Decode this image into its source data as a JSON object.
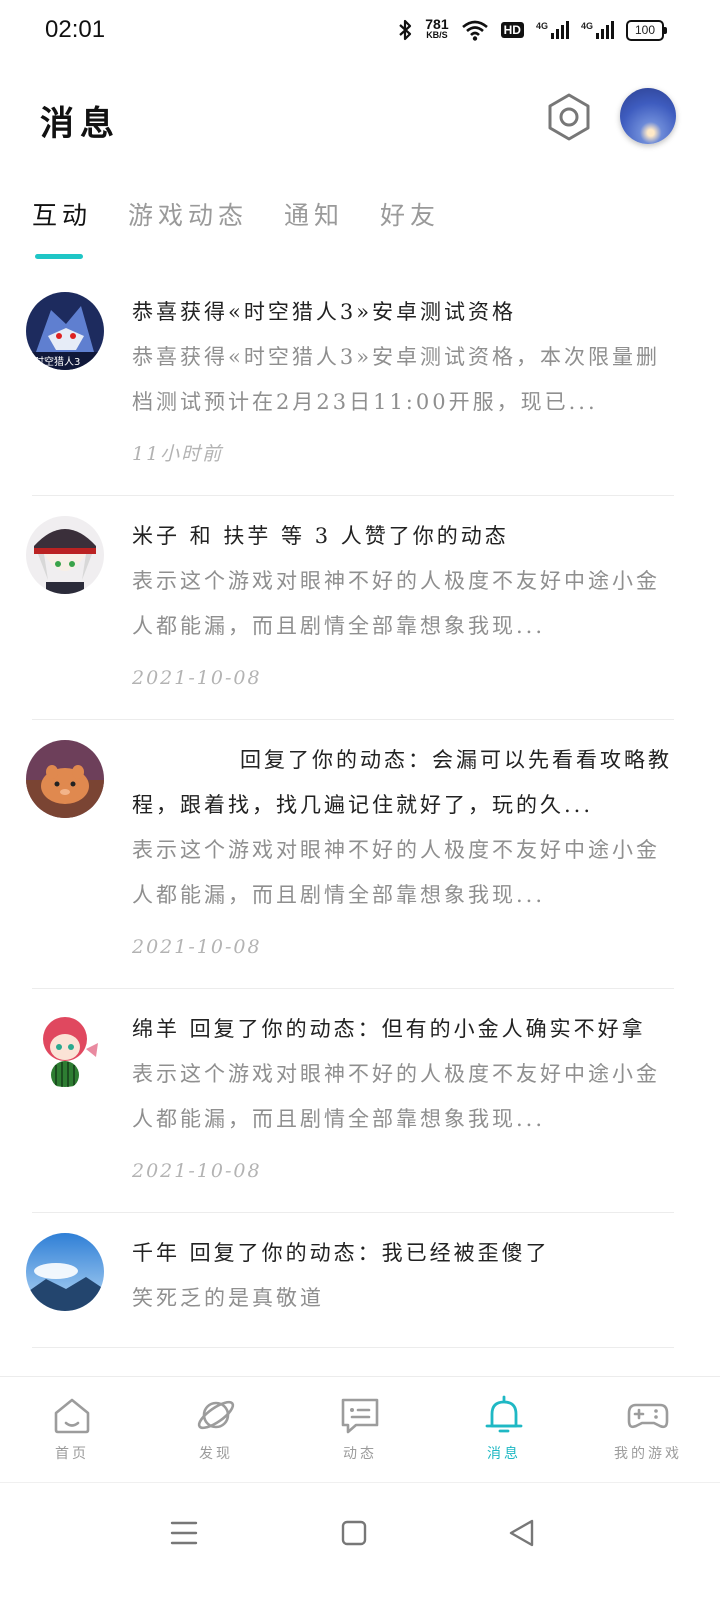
{
  "status_bar": {
    "time": "02:01",
    "net_speed_value": "781",
    "net_speed_unit": "KB/S",
    "hd_label": "HD",
    "signal_1_label": "4G",
    "signal_2_label": "4G",
    "battery_level": "100",
    "icons": [
      "bluetooth-icon",
      "wifi-icon",
      "hd-icon",
      "signal-icon",
      "battery-icon"
    ]
  },
  "header": {
    "title": "消息",
    "settings_icon": "hexagon-settings-icon"
  },
  "tabs": [
    {
      "label": "互动",
      "active": true
    },
    {
      "label": "游戏动态",
      "active": false
    },
    {
      "label": "通知",
      "active": false
    },
    {
      "label": "好友",
      "active": false
    }
  ],
  "accent_color": "#1fc6c6",
  "messages": [
    {
      "title": "恭喜获得«时空猎人3»安卓测试资格",
      "body": "恭喜获得«时空猎人3»安卓测试资格，本次限量删档测试预计在2月23日11:00开服，现已...",
      "time": "11小时前"
    },
    {
      "title": "米子 和 扶芋 等 3 人赞了你的动态",
      "body": "表示这个游戏对眼神不好的人极度不友好中途小金人都能漏，而且剧情全部靠想象我现...",
      "time": "2021-10-08"
    },
    {
      "title": "回复了你的动态：会漏可以先看看攻略教程，跟着找，找几遍记住就好了，玩的久...",
      "body": "表示这个游戏对眼神不好的人极度不友好中途小金人都能漏，而且剧情全部靠想象我现...",
      "time": "2021-10-08"
    },
    {
      "title": "绵羊 回复了你的动态：但有的小金人确实不好拿",
      "body": "表示这个游戏对眼神不好的人极度不友好中途小金人都能漏，而且剧情全部靠想象我现...",
      "time": "2021-10-08"
    },
    {
      "title": "千年 回复了你的动态：我已经被歪傻了",
      "body": "笑死乏的是真敬道"
    }
  ],
  "bottom_nav": [
    {
      "label": "首页",
      "icon": "home-icon",
      "active": false
    },
    {
      "label": "发现",
      "icon": "planet-icon",
      "active": false
    },
    {
      "label": "动态",
      "icon": "chat-icon",
      "active": false
    },
    {
      "label": "消息",
      "icon": "bell-icon",
      "active": true
    },
    {
      "label": "我的游戏",
      "icon": "gamepad-icon",
      "active": false
    }
  ]
}
